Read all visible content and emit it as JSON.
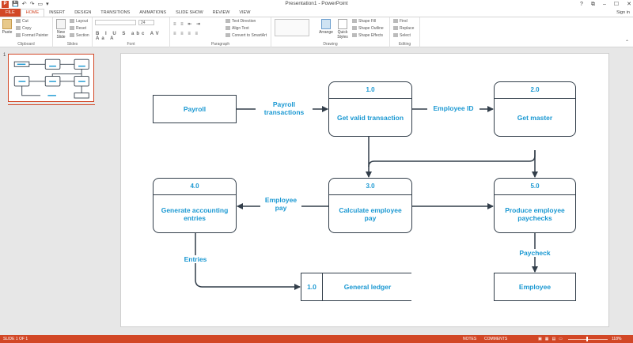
{
  "window": {
    "title": "Presentation1 - PowerPoint",
    "controls": [
      "?",
      "⧉",
      "–",
      "☐",
      "✕"
    ],
    "quick_access": [
      "💾",
      "↶",
      "↷",
      "▭",
      "▾"
    ]
  },
  "tabs": [
    "FILE",
    "HOME",
    "INSERT",
    "DESIGN",
    "TRANSITIONS",
    "ANIMATIONS",
    "SLIDE SHOW",
    "REVIEW",
    "VIEW"
  ],
  "sign_in": "Sign in",
  "ribbon": {
    "clipboard": {
      "name": "Clipboard",
      "paste": "Paste",
      "cut": "Cut",
      "copy": "Copy",
      "format_painter": "Format Painter"
    },
    "slides": {
      "name": "Slides",
      "new_slide": "New Slide",
      "layout": "Layout",
      "reset": "Reset",
      "section": "Section"
    },
    "font": {
      "name": "Font",
      "size": "24",
      "format_row": "B I U S abc AV Aa A"
    },
    "paragraph": {
      "name": "Paragraph",
      "text_direction": "Text Direction",
      "align_text": "Align Text",
      "convert_smartart": "Convert to SmartArt"
    },
    "drawing": {
      "name": "Drawing",
      "arrange": "Arrange",
      "quick_styles": "Quick Styles",
      "shape_fill": "Shape Fill",
      "shape_outline": "Shape Outline",
      "shape_effects": "Shape Effects"
    },
    "editing": {
      "name": "Editing",
      "find": "Find",
      "replace": "Replace",
      "select": "Select"
    }
  },
  "thumbnails": {
    "slide_number": "1"
  },
  "diagram": {
    "payroll": "Payroll",
    "payroll_transactions": "Payroll transactions",
    "p1": {
      "id": "1.0",
      "name": "Get valid transaction"
    },
    "employee_id": "Employee ID",
    "p2": {
      "id": "2.0",
      "name": "Get master"
    },
    "p3": {
      "id": "3.0",
      "name": "Calculate employee pay"
    },
    "p4": {
      "id": "4.0",
      "name": "Generate accounting entries"
    },
    "p5": {
      "id": "5.0",
      "name": "Produce employee paychecks"
    },
    "employee_pay": "Employee pay",
    "entries": "Entries",
    "paycheck": "Paycheck",
    "ledger": {
      "id": "1.0",
      "name": "General ledger"
    },
    "employee": "Employee"
  },
  "status": {
    "slide": "SLIDE 1 OF 1",
    "notes": "NOTES",
    "comments": "COMMENTS",
    "zoom": "118%",
    "accent": "#d24726"
  }
}
